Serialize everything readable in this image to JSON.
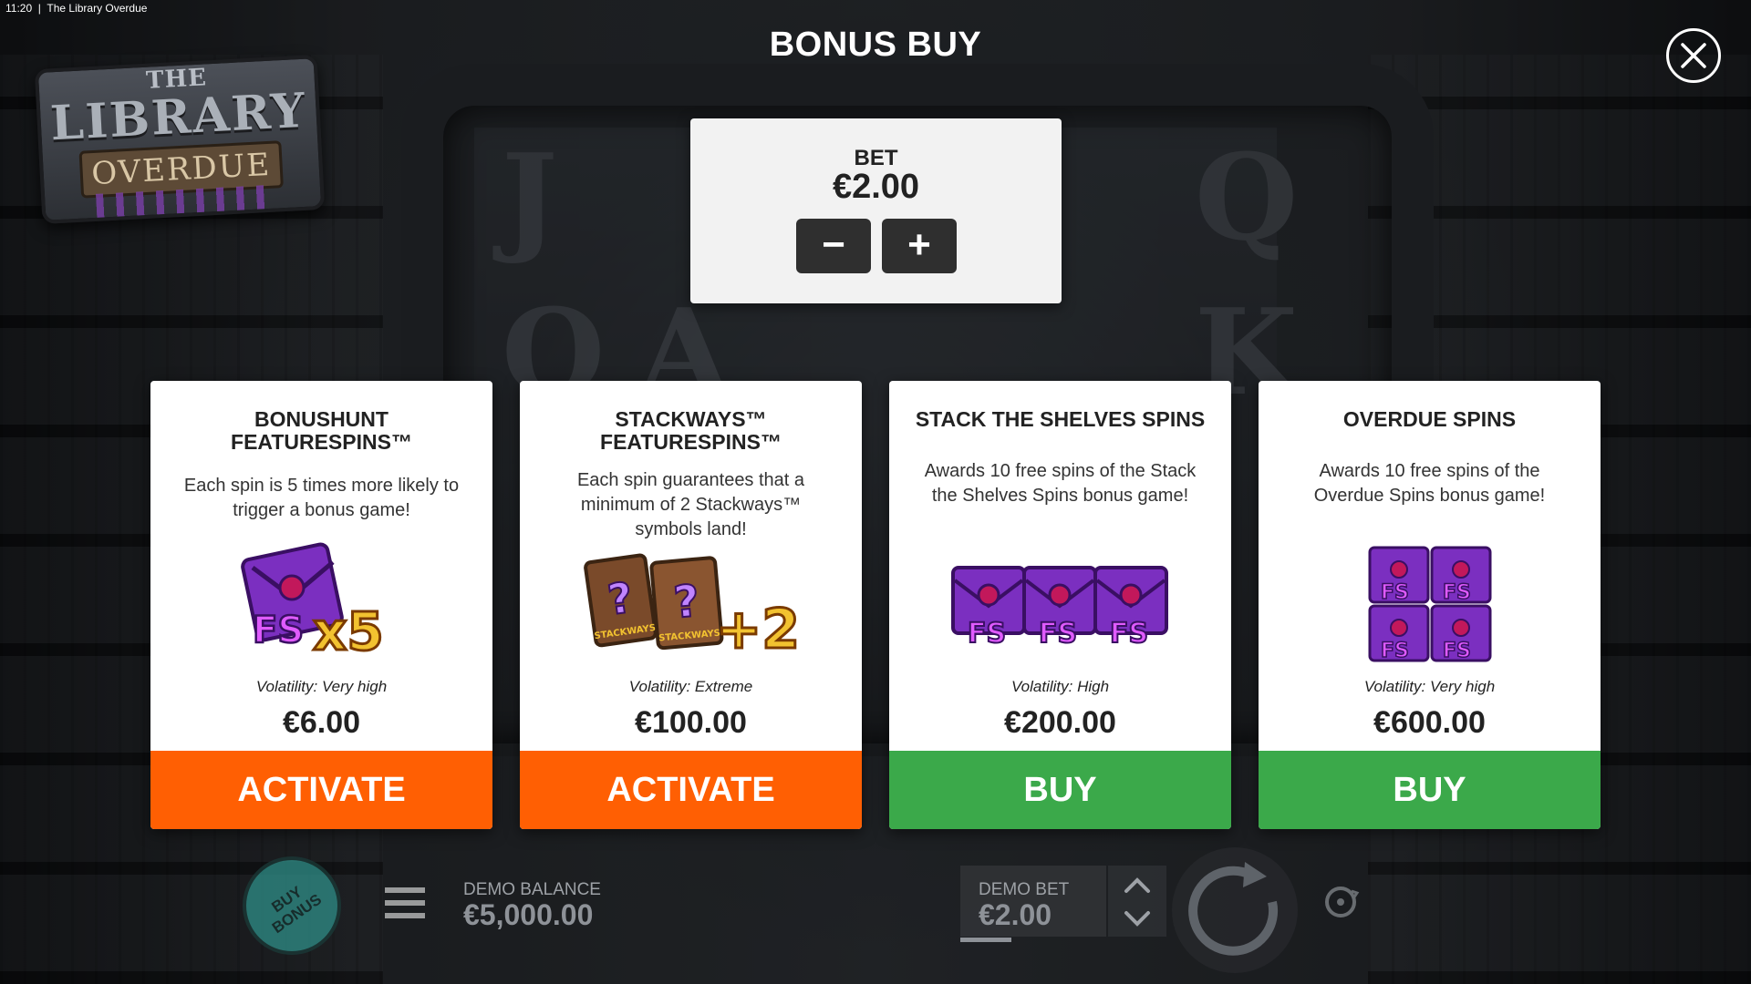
{
  "status": {
    "time": "11:20",
    "window_title": "The Library Overdue"
  },
  "logo": {
    "line1": "THE",
    "line2": "LIBRARY",
    "line3": "OVERDUE"
  },
  "title": "BONUS BUY",
  "bet": {
    "label": "BET",
    "value": "€2.00",
    "minus_label": "−",
    "plus_label": "+"
  },
  "cards": [
    {
      "title": "BONUSHUNT\nFEATURESPINS™",
      "description": "Each spin is 5 times more likely to\ntrigger a bonus game!",
      "art": {
        "icon": "fs-envelope-x5-icon",
        "badge": "FS",
        "multiplier": "x5"
      },
      "volatility": "Volatility: Very high",
      "price": "€6.00",
      "button": "ACTIVATE",
      "button_color": "#ff5f03"
    },
    {
      "title": "STACKWAYS™\nFEATURESPINS™",
      "description": "Each spin guarantees that a\nminimum of 2 Stackways™\nsymbols land!",
      "art": {
        "icon": "stackways-cards-plus2-icon",
        "card_text": "STACKWAYS",
        "mystery": "?",
        "modifier": "+2"
      },
      "volatility": "Volatility: Extreme",
      "price": "€100.00",
      "button": "ACTIVATE",
      "button_color": "#ff5f03"
    },
    {
      "title": "STACK THE SHELVES SPINS",
      "description": "Awards 10 free spins of the Stack\nthe Shelves Spins bonus game!",
      "art": {
        "icon": "three-fs-envelopes-icon",
        "badge": "FS"
      },
      "volatility": "Volatility: High",
      "price": "€200.00",
      "button": "BUY",
      "button_color": "#3ba94a"
    },
    {
      "title": "OVERDUE SPINS",
      "description": "Awards 10 free spins of the\nOverdue Spins bonus game!",
      "art": {
        "icon": "four-fs-envelopes-icon",
        "badge": "FS"
      },
      "volatility": "Volatility: Very high",
      "price": "€600.00",
      "button": "BUY",
      "button_color": "#3ba94a"
    }
  ],
  "bottom_bar": {
    "buy_bonus": "BUY\nBONUS",
    "balance_label": "DEMO BALANCE",
    "balance_value": "€5,000.00",
    "demo_bet_label": "DEMO BET",
    "demo_bet_value": "€2.00"
  },
  "colors": {
    "activate": "#ff5f03",
    "buy": "#3ba94a",
    "panel": "#f2f2f2",
    "fs_purple": "#8b2fc9",
    "gold": "#f2c230"
  }
}
